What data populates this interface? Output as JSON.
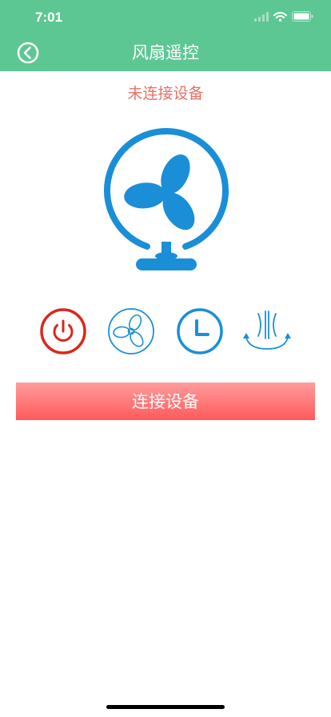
{
  "status_bar": {
    "time": "7:01"
  },
  "nav": {
    "title": "风扇遥控",
    "back_icon": "chevron-left-circle-icon"
  },
  "device": {
    "status": "未连接设备",
    "illustration_icon": "desk-fan-icon"
  },
  "controls": [
    {
      "icon": "power-icon",
      "color": "#d9281c"
    },
    {
      "icon": "fan-speed-icon",
      "color": "#1a8fd8"
    },
    {
      "icon": "timer-icon",
      "color": "#1a8fd8"
    },
    {
      "icon": "oscillate-icon",
      "color": "#1a8fd8"
    }
  ],
  "connect_button": {
    "label": "连接设备"
  },
  "colors": {
    "header": "#5dc794",
    "status_text": "#e87068",
    "fan_blue": "#1a8fd8",
    "power_red": "#d9281c",
    "button_gradient_top": "#ff9c9c",
    "button_gradient_bottom": "#ff5a5a"
  }
}
